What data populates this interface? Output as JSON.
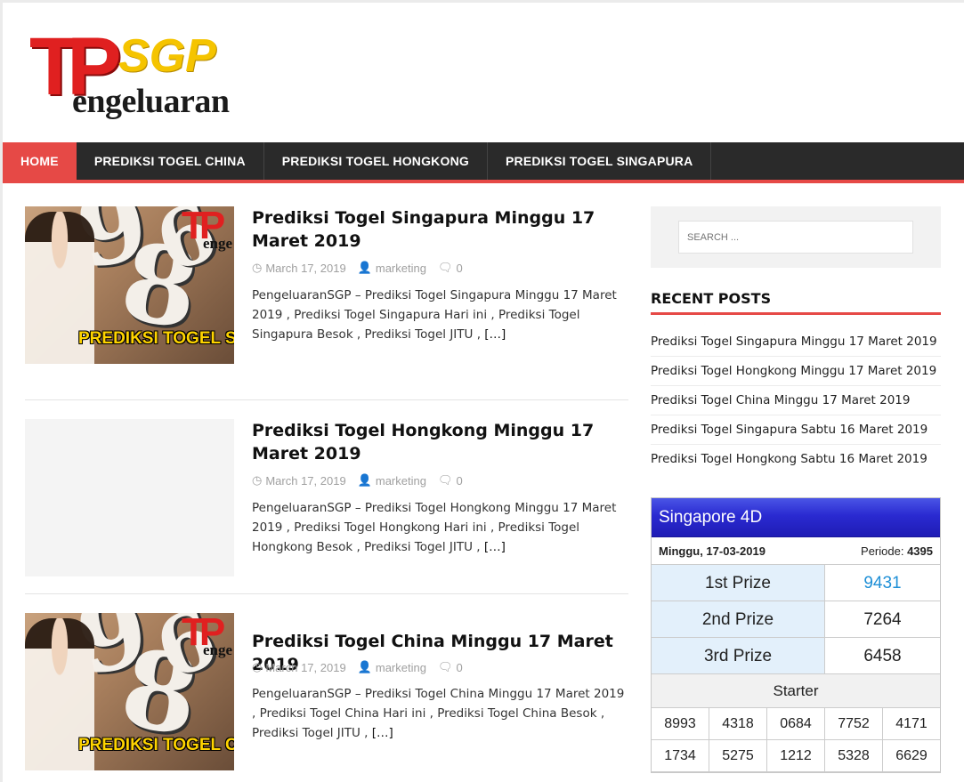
{
  "logo": {
    "tp": "TP",
    "sgp": "SGP",
    "word": "engeluaran"
  },
  "nav": [
    "HOME",
    "PREDIKSI TOGEL CHINA",
    "PREDIKSI TOGEL HONGKONG",
    "PREDIKSI TOGEL SINGAPURA"
  ],
  "posts": [
    {
      "title": "Prediksi Togel Singapura Minggu 17 Maret 2019",
      "date": "March 17, 2019",
      "author": "marketing",
      "comments": "0",
      "excerpt": "PengeluaranSGP – Prediksi Togel Singapura Minggu 17 Maret 2019 , Prediksi Togel Singapura Hari ini , Prediksi Togel Singapura Besok , Prediksi Togel JITU , ",
      "more": "[…]",
      "thumb_banner": "PREDIKSI TOGEL SINGAPURA",
      "thumb_word": "enge"
    },
    {
      "title": "Prediksi Togel Hongkong Minggu 17 Maret 2019",
      "date": "March 17, 2019",
      "author": "marketing",
      "comments": "0",
      "excerpt": "PengeluaranSGP – Prediksi Togel Hongkong Minggu 17 Maret 2019 , Prediksi Togel Hongkong Hari ini , Prediksi Togel Hongkong Besok , Prediksi Togel JITU , ",
      "more": "[…]"
    },
    {
      "title": "Prediksi Togel China Minggu 17 Maret 2019",
      "date": "March 17, 2019",
      "author": "marketing",
      "comments": "0",
      "excerpt": "PengeluaranSGP – Prediksi Togel China Minggu 17 Maret 2019 , Prediksi Togel China Hari ini , Prediksi Togel China Besok , Prediksi Togel JITU , ",
      "more": "[…]",
      "thumb_banner": "PREDIKSI TOGEL CHINA",
      "thumb_word": "enge"
    }
  ],
  "sidebar": {
    "search_placeholder": "SEARCH ...",
    "recent_title": "RECENT POSTS",
    "recent": [
      "Prediksi Togel Singapura Minggu 17 Maret 2019",
      "Prediksi Togel Hongkong Minggu 17 Maret 2019",
      "Prediksi Togel China Minggu 17 Maret 2019",
      "Prediksi Togel Singapura Sabtu 16 Maret 2019",
      "Prediksi Togel Hongkong Sabtu 16 Maret 2019"
    ]
  },
  "sg4d": {
    "title": "Singapore 4D",
    "date": "Minggu, 17-03-2019",
    "periode_label": "Periode:",
    "periode": "4395",
    "prizes": [
      {
        "label": "1st Prize",
        "value": "9431"
      },
      {
        "label": "2nd Prize",
        "value": "7264"
      },
      {
        "label": "3rd Prize",
        "value": "6458"
      }
    ],
    "starter_title": "Starter",
    "starter": [
      [
        "8993",
        "4318",
        "0684",
        "7752",
        "4171"
      ],
      [
        "1734",
        "5275",
        "1212",
        "5328",
        "6629"
      ]
    ],
    "colors": {
      "accent": "#e64946",
      "nav_bg": "#2a2a2a",
      "header_blue": "#2a2ad1",
      "first_prize": "#1e8fd6"
    }
  },
  "icons": {
    "date": "clock-icon",
    "author": "user-icon",
    "comments": "comment-icon"
  }
}
